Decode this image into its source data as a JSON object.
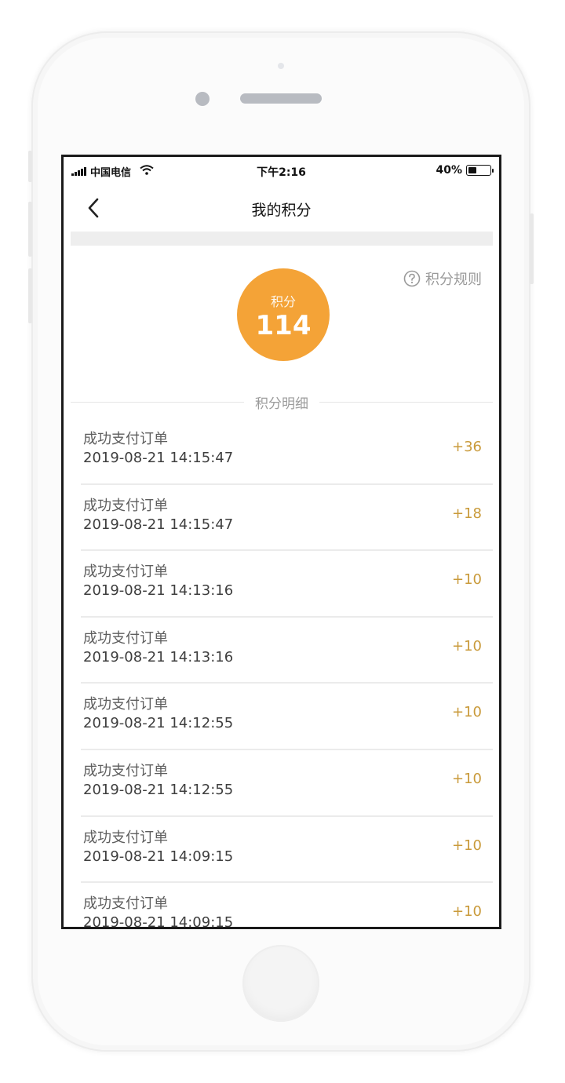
{
  "status_bar": {
    "carrier": "中国电信",
    "time": "下午2:16",
    "battery": "40%",
    "battery_level": 0.4
  },
  "header": {
    "title": "我的积分",
    "back_icon": "chevron-left-icon"
  },
  "points_summary": {
    "label": "积分",
    "value": "114",
    "circle_color": "#f4a337"
  },
  "rules_link": {
    "icon": "question-circle-icon",
    "label": "积分规则"
  },
  "details_section": {
    "title": "积分明细"
  },
  "transactions": [
    {
      "title": "成功支付订单",
      "datetime": "2019-08-21 14:15:47",
      "points": "+36"
    },
    {
      "title": "成功支付订单",
      "datetime": "2019-08-21 14:15:47",
      "points": "+18"
    },
    {
      "title": "成功支付订单",
      "datetime": "2019-08-21 14:13:16",
      "points": "+10"
    },
    {
      "title": "成功支付订单",
      "datetime": "2019-08-21 14:13:16",
      "points": "+10"
    },
    {
      "title": "成功支付订单",
      "datetime": "2019-08-21 14:12:55",
      "points": "+10"
    },
    {
      "title": "成功支付订单",
      "datetime": "2019-08-21 14:12:55",
      "points": "+10"
    },
    {
      "title": "成功支付订单",
      "datetime": "2019-08-21 14:09:15",
      "points": "+10"
    },
    {
      "title": "成功支付订单",
      "datetime": "2019-08-21 14:09:15",
      "points": "+10"
    }
  ],
  "colors": {
    "accent": "#f4a337",
    "points_text": "#c99a3a"
  }
}
